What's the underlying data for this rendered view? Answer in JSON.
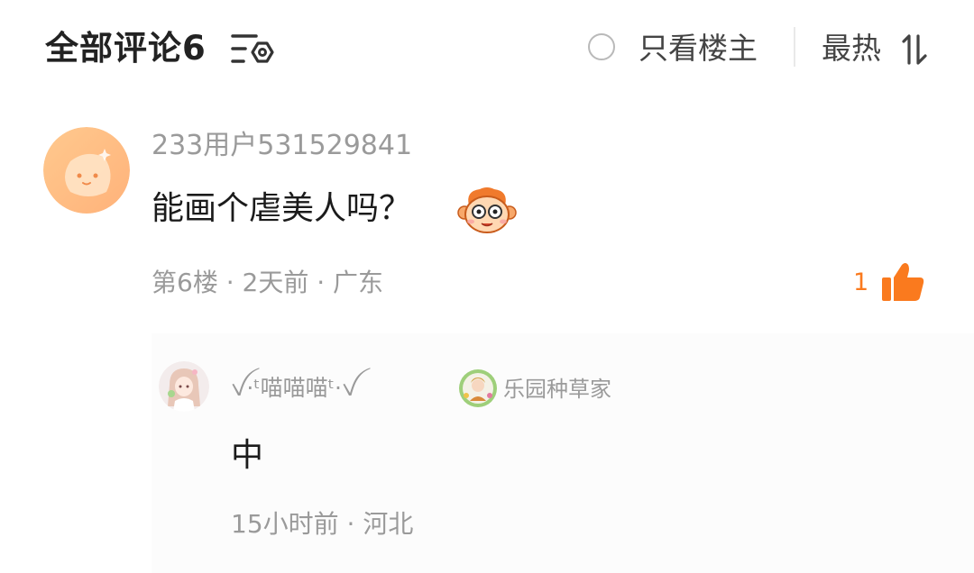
{
  "header": {
    "title": "全部评论6",
    "filter_icon": "filter-settings-icon",
    "op_only_label": "只看楼主",
    "sort_label": "最热",
    "sort_icon": "sort-toggle-icon"
  },
  "comment": {
    "avatar_icon": "default-orange-avatar",
    "username": "233用户531529841",
    "content": "能画个虐美人吗？",
    "emoji_icon": "monkey-face-emoji",
    "meta": "第6楼 · 2天前 · 广东",
    "like_count": "1",
    "like_icon": "thumbs-up-icon",
    "accent_color": "#fa7a1e"
  },
  "reply": {
    "avatar_icon": "anime-girl-avatar",
    "username": "ꪜ·ᵗ喵喵喵ᵗ·ꪜ",
    "badge_icon": "paradise-gardener-badge",
    "badge_label": "乐园种草家",
    "content": "中",
    "meta": "15小时前 · 河北"
  }
}
